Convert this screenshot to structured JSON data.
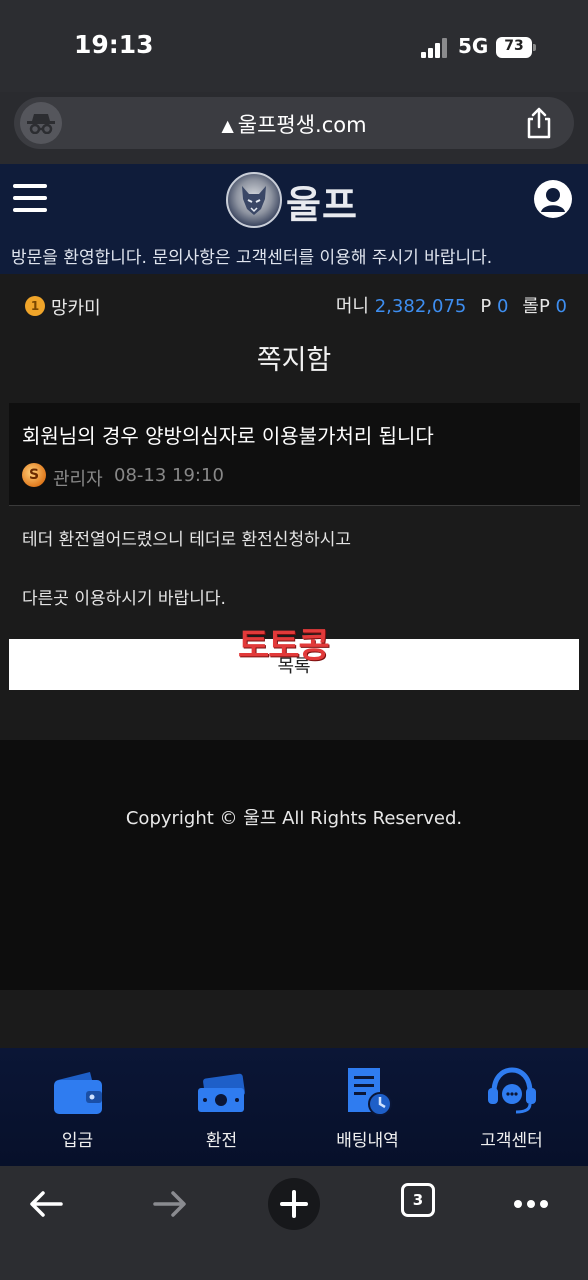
{
  "status_bar": {
    "time": "19:13",
    "network": "5G",
    "battery": "73"
  },
  "browser": {
    "url": "울프평생.com",
    "open_tabs": "3"
  },
  "site": {
    "logo_text": "울프",
    "welcome_message": "방문을 환영합니다. 문의사항은 고객센터를 이용해 주시기 바랍니다."
  },
  "user": {
    "level": "1",
    "name": "망카미",
    "money_label": "머니",
    "money_value": "2,382,075",
    "point_label": "P",
    "point_value": "0",
    "rolling_label": "롤P",
    "rolling_value": "0"
  },
  "page_title": "쪽지함",
  "message": {
    "subject": "회원님의 경우 양방의심자로 이용불가처리 됩니다",
    "sender_badge": "S",
    "sender": "관리자",
    "date": "08-13 19:10",
    "body_lines": [
      "테더 환전열어드렸으니 테더로 환전신청하시고",
      "다른곳 이용하시기 바랍니다."
    ]
  },
  "list_button_label": "목록",
  "watermark_text": "토토콩",
  "footer": {
    "copyright": "Copyright © 울프 All Rights Reserved."
  },
  "tabbar": [
    {
      "label": "입금",
      "icon": "wallet-icon"
    },
    {
      "label": "환전",
      "icon": "cash-icon"
    },
    {
      "label": "배팅내역",
      "icon": "receipt-icon"
    },
    {
      "label": "고객센터",
      "icon": "headset-icon"
    }
  ],
  "colors": {
    "accent": "#3e8ef0",
    "header_bg": "#0f1c3a",
    "tab_icon": "#2f7cf0",
    "watermark": "#e23a3a"
  }
}
